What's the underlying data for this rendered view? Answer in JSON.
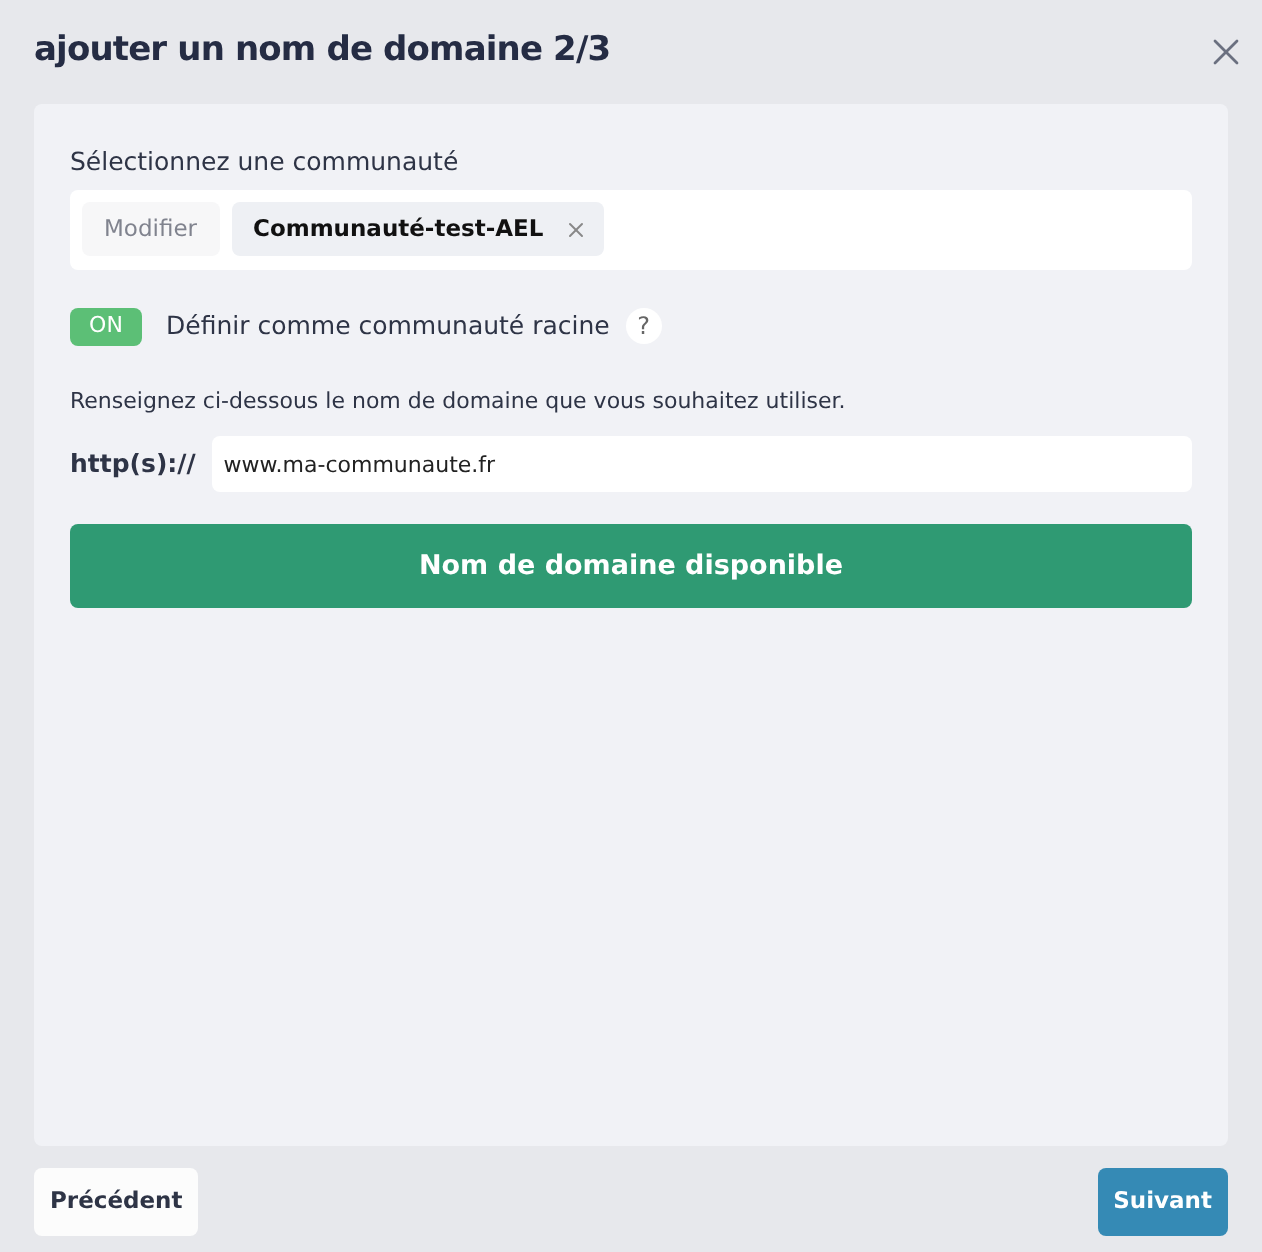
{
  "dialog": {
    "title": "ajouter un nom de domaine 2/3"
  },
  "community": {
    "label": "Sélectionnez une communauté",
    "modify_button": "Modifier",
    "tag": "Communauté-test-AEL"
  },
  "root_toggle": {
    "state_text": "ON",
    "on": true,
    "label": "Définir comme communauté racine",
    "help": "?"
  },
  "domain": {
    "instruction": "Renseignez ci-dessous le nom de domaine que vous souhaitez utiliser.",
    "prefix": "http(s)://",
    "value": "www.ma-communaute.fr"
  },
  "availability_button": "Nom de domaine disponible",
  "footer": {
    "previous": "Précédent",
    "next": "Suivant"
  }
}
